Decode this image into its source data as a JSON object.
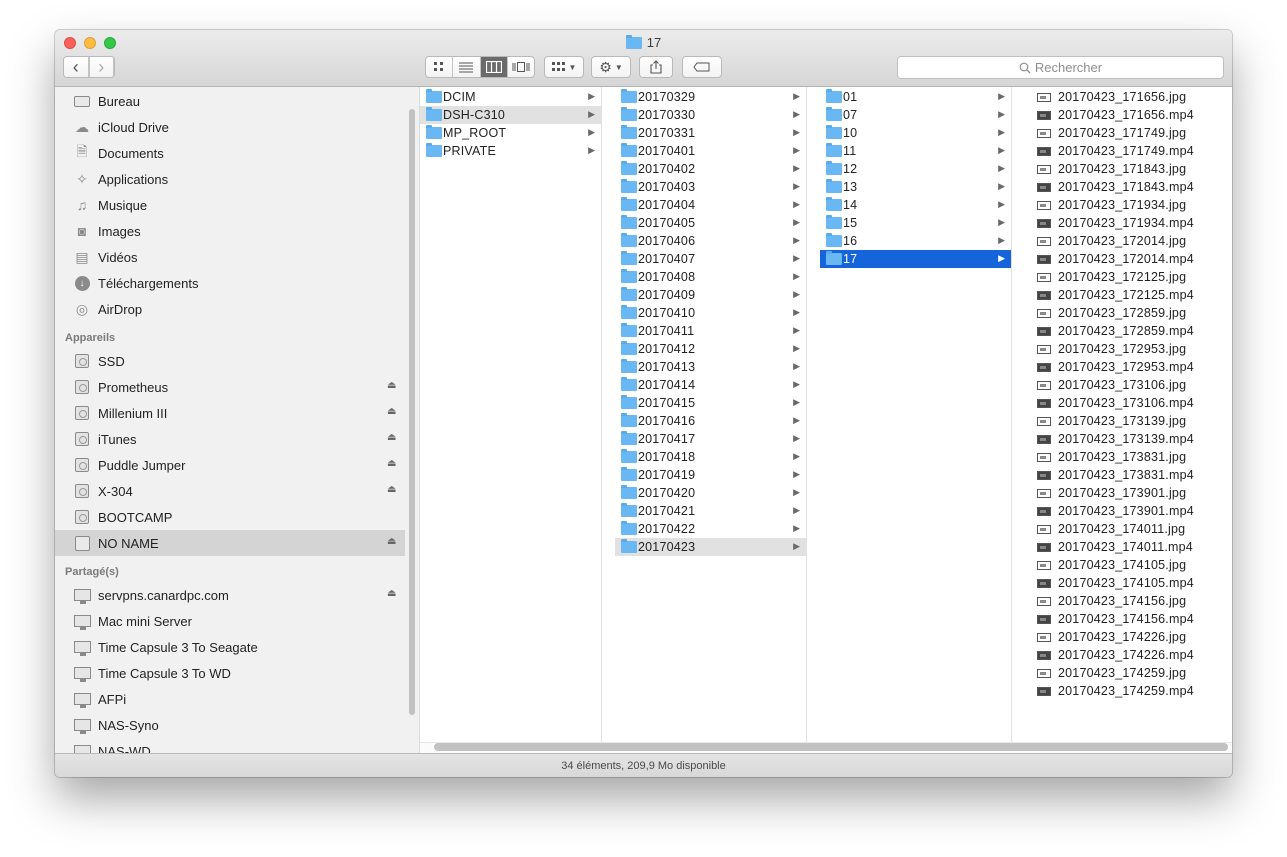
{
  "window": {
    "title": "17"
  },
  "toolbar": {
    "back": "‹",
    "forward": "›",
    "search_placeholder": "Rechercher"
  },
  "sidebar": {
    "favorites": [
      {
        "label": "Bureau",
        "icon": "desktop-icon"
      },
      {
        "label": "iCloud Drive",
        "icon": "cloud-icon"
      },
      {
        "label": "Documents",
        "icon": "documents-icon"
      },
      {
        "label": "Applications",
        "icon": "applications-icon"
      },
      {
        "label": "Musique",
        "icon": "music-icon"
      },
      {
        "label": "Images",
        "icon": "camera-icon"
      },
      {
        "label": "Vidéos",
        "icon": "film-icon"
      },
      {
        "label": "Téléchargements",
        "icon": "download-icon"
      },
      {
        "label": "AirDrop",
        "icon": "airdrop-icon"
      }
    ],
    "devices_header": "Appareils",
    "devices": [
      {
        "label": "SSD",
        "eject": false
      },
      {
        "label": "Prometheus",
        "eject": true
      },
      {
        "label": "Millenium III",
        "eject": true
      },
      {
        "label": "iTunes",
        "eject": true
      },
      {
        "label": "Puddle Jumper",
        "eject": true
      },
      {
        "label": "X-304",
        "eject": true
      },
      {
        "label": "BOOTCAMP",
        "eject": false
      },
      {
        "label": "NO NAME",
        "eject": true,
        "selected": true
      }
    ],
    "shared_header": "Partagé(s)",
    "shared": [
      {
        "label": "servpns.canardpc.com",
        "eject": true
      },
      {
        "label": "Mac mini Server",
        "eject": false
      },
      {
        "label": "Time Capsule 3 To Seagate",
        "eject": false
      },
      {
        "label": "Time Capsule 3 To WD",
        "eject": false
      },
      {
        "label": "AFPi",
        "eject": false
      },
      {
        "label": "NAS-Syno",
        "eject": false
      },
      {
        "label": "NAS-WD",
        "eject": false
      }
    ]
  },
  "columns": [
    {
      "items": [
        "DCIM",
        "DSH-C310",
        "MP_ROOT",
        "PRIVATE"
      ],
      "selected": 1,
      "active": false
    },
    {
      "items": [
        "20170329",
        "20170330",
        "20170331",
        "20170401",
        "20170402",
        "20170403",
        "20170404",
        "20170405",
        "20170406",
        "20170407",
        "20170408",
        "20170409",
        "20170410",
        "20170411",
        "20170412",
        "20170413",
        "20170414",
        "20170415",
        "20170416",
        "20170417",
        "20170418",
        "20170419",
        "20170420",
        "20170421",
        "20170422",
        "20170423"
      ],
      "selected": 25,
      "active": false
    },
    {
      "items": [
        "01",
        "07",
        "10",
        "11",
        "12",
        "13",
        "14",
        "15",
        "16",
        "17"
      ],
      "selected": 9,
      "active": true
    }
  ],
  "files": [
    "20170423_171656.jpg",
    "20170423_171656.mp4",
    "20170423_171749.jpg",
    "20170423_171749.mp4",
    "20170423_171843.jpg",
    "20170423_171843.mp4",
    "20170423_171934.jpg",
    "20170423_171934.mp4",
    "20170423_172014.jpg",
    "20170423_172014.mp4",
    "20170423_172125.jpg",
    "20170423_172125.mp4",
    "20170423_172859.jpg",
    "20170423_172859.mp4",
    "20170423_172953.jpg",
    "20170423_172953.mp4",
    "20170423_173106.jpg",
    "20170423_173106.mp4",
    "20170423_173139.jpg",
    "20170423_173139.mp4",
    "20170423_173831.jpg",
    "20170423_173831.mp4",
    "20170423_173901.jpg",
    "20170423_173901.mp4",
    "20170423_174011.jpg",
    "20170423_174011.mp4",
    "20170423_174105.jpg",
    "20170423_174105.mp4",
    "20170423_174156.jpg",
    "20170423_174156.mp4",
    "20170423_174226.jpg",
    "20170423_174226.mp4",
    "20170423_174259.jpg",
    "20170423_174259.mp4"
  ],
  "status": {
    "text": "34 éléments, 209,9 Mo disponible"
  },
  "colors": {
    "accent": "#1664d9",
    "folder": "#6ab8f3"
  }
}
